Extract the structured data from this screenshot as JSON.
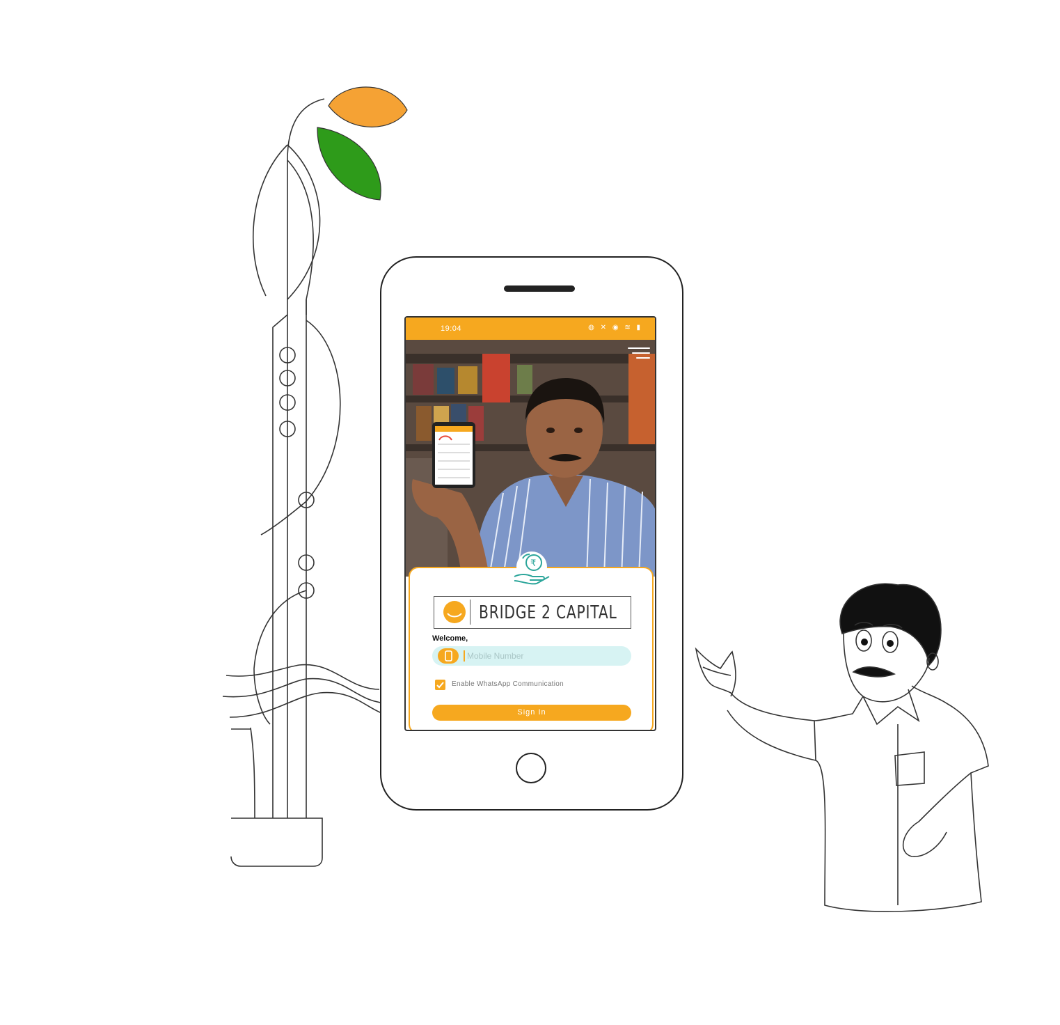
{
  "status_bar": {
    "time": "19:04",
    "icons": "◍ ✕ ◉ ≋ ▮"
  },
  "login": {
    "welcome": "Welcome,",
    "mobile_placeholder": "Mobile Number",
    "whatsapp_label": "Enable WhatsApp Communication",
    "whatsapp_checked": true,
    "signin_label": "Sign In"
  },
  "brand": {
    "logo_text": "BRIDGE 2 CAPITAL"
  },
  "colors": {
    "accent": "#f6a81f",
    "input_bg": "#d7f3f3",
    "leaf_orange": "#f5a234",
    "leaf_green": "#2e9b1a",
    "icon_teal": "#2ba59a"
  },
  "icons": {
    "menu": "hamburger-menu-icon",
    "rupee_hand": "rupee-hand-icon",
    "phone": "mobile-phone-icon",
    "check": "checkmark-icon"
  }
}
